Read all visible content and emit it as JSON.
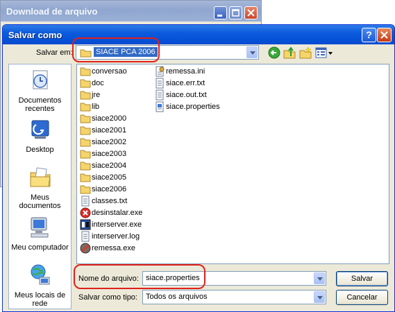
{
  "background_window": {
    "title": "Download de arquivo"
  },
  "dialog": {
    "title": "Salvar como",
    "help_label": "?",
    "close_label": "✕"
  },
  "toolbar": {
    "save_in_label": "Salvar em:",
    "save_in_value": "SIACE PCA 2006",
    "icons": [
      "back-icon",
      "up-folder-icon",
      "new-folder-icon",
      "view-menu-icon"
    ]
  },
  "places": [
    {
      "label": "Documentos recentes",
      "icon": "recent-documents-icon"
    },
    {
      "label": "Desktop",
      "icon": "desktop-icon"
    },
    {
      "label": "Meus documentos",
      "icon": "my-documents-icon"
    },
    {
      "label": "Meu computador",
      "icon": "my-computer-icon"
    },
    {
      "label": "Meus locais de rede",
      "icon": "network-places-icon"
    }
  ],
  "files": {
    "column1": [
      {
        "name": "conversao",
        "icon": "folder-icon"
      },
      {
        "name": "doc",
        "icon": "folder-icon"
      },
      {
        "name": "jre",
        "icon": "folder-icon"
      },
      {
        "name": "lib",
        "icon": "folder-icon"
      },
      {
        "name": "siace2000",
        "icon": "folder-icon"
      },
      {
        "name": "siace2001",
        "icon": "folder-icon"
      },
      {
        "name": "siace2002",
        "icon": "folder-icon"
      },
      {
        "name": "siace2003",
        "icon": "folder-icon"
      },
      {
        "name": "siace2004",
        "icon": "folder-icon"
      },
      {
        "name": "siace2005",
        "icon": "folder-icon"
      },
      {
        "name": "siace2006",
        "icon": "folder-icon"
      },
      {
        "name": "classes.txt",
        "icon": "text-file-icon"
      },
      {
        "name": "desinstalar.exe",
        "icon": "uninstall-exe-icon"
      },
      {
        "name": "interserver.exe",
        "icon": "exe-icon"
      },
      {
        "name": "interserver.log",
        "icon": "text-file-icon"
      },
      {
        "name": "remessa.exe",
        "icon": "remessa-exe-icon"
      }
    ],
    "column2": [
      {
        "name": "remessa.ini",
        "icon": "ini-file-icon"
      },
      {
        "name": "siace.err.txt",
        "icon": "text-file-icon"
      },
      {
        "name": "siace.out.txt",
        "icon": "text-file-icon"
      },
      {
        "name": "siace.properties",
        "icon": "properties-file-icon"
      }
    ]
  },
  "bottom": {
    "file_name_label": "Nome do arquivo:",
    "file_name_value": "siace.properties",
    "file_type_label": "Salvar como tipo:",
    "file_type_value": "Todos os arquivos",
    "save_button": "Salvar",
    "cancel_button": "Cancelar"
  },
  "colors": {
    "titlebar_active": "#0c5bdc",
    "titlebar_inactive": "#9bb0d6",
    "dialog_bg": "#ece9d8",
    "selection": "#316ac5",
    "annotation_red": "#e0201a",
    "folder_yellow": "#f5d46a"
  }
}
